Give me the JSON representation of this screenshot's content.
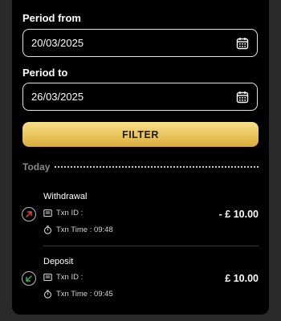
{
  "filters": {
    "period_from_label": "Period from",
    "period_from_value": "20/03/2025",
    "period_to_label": "Period to",
    "period_to_value": "26/03/2025",
    "filter_button": "FILTER"
  },
  "group_label": "Today",
  "transactions": [
    {
      "type": "Withdrawal",
      "txn_id_label": "Txn ID :",
      "txn_time": "Txn Time : 09:48",
      "amount": "- £ 10.00",
      "icon": "arrow-up-right-icon",
      "icon_color": "#e2483d"
    },
    {
      "type": "Deposit",
      "txn_id_label": "Txn ID :",
      "txn_time": "Txn Time : 09:45",
      "amount": "£ 10.00",
      "icon": "arrow-down-left-icon",
      "icon_color": "#2bbf4a"
    }
  ],
  "colors": {
    "accent_gold": "#e9c35a",
    "background": "#000000"
  }
}
